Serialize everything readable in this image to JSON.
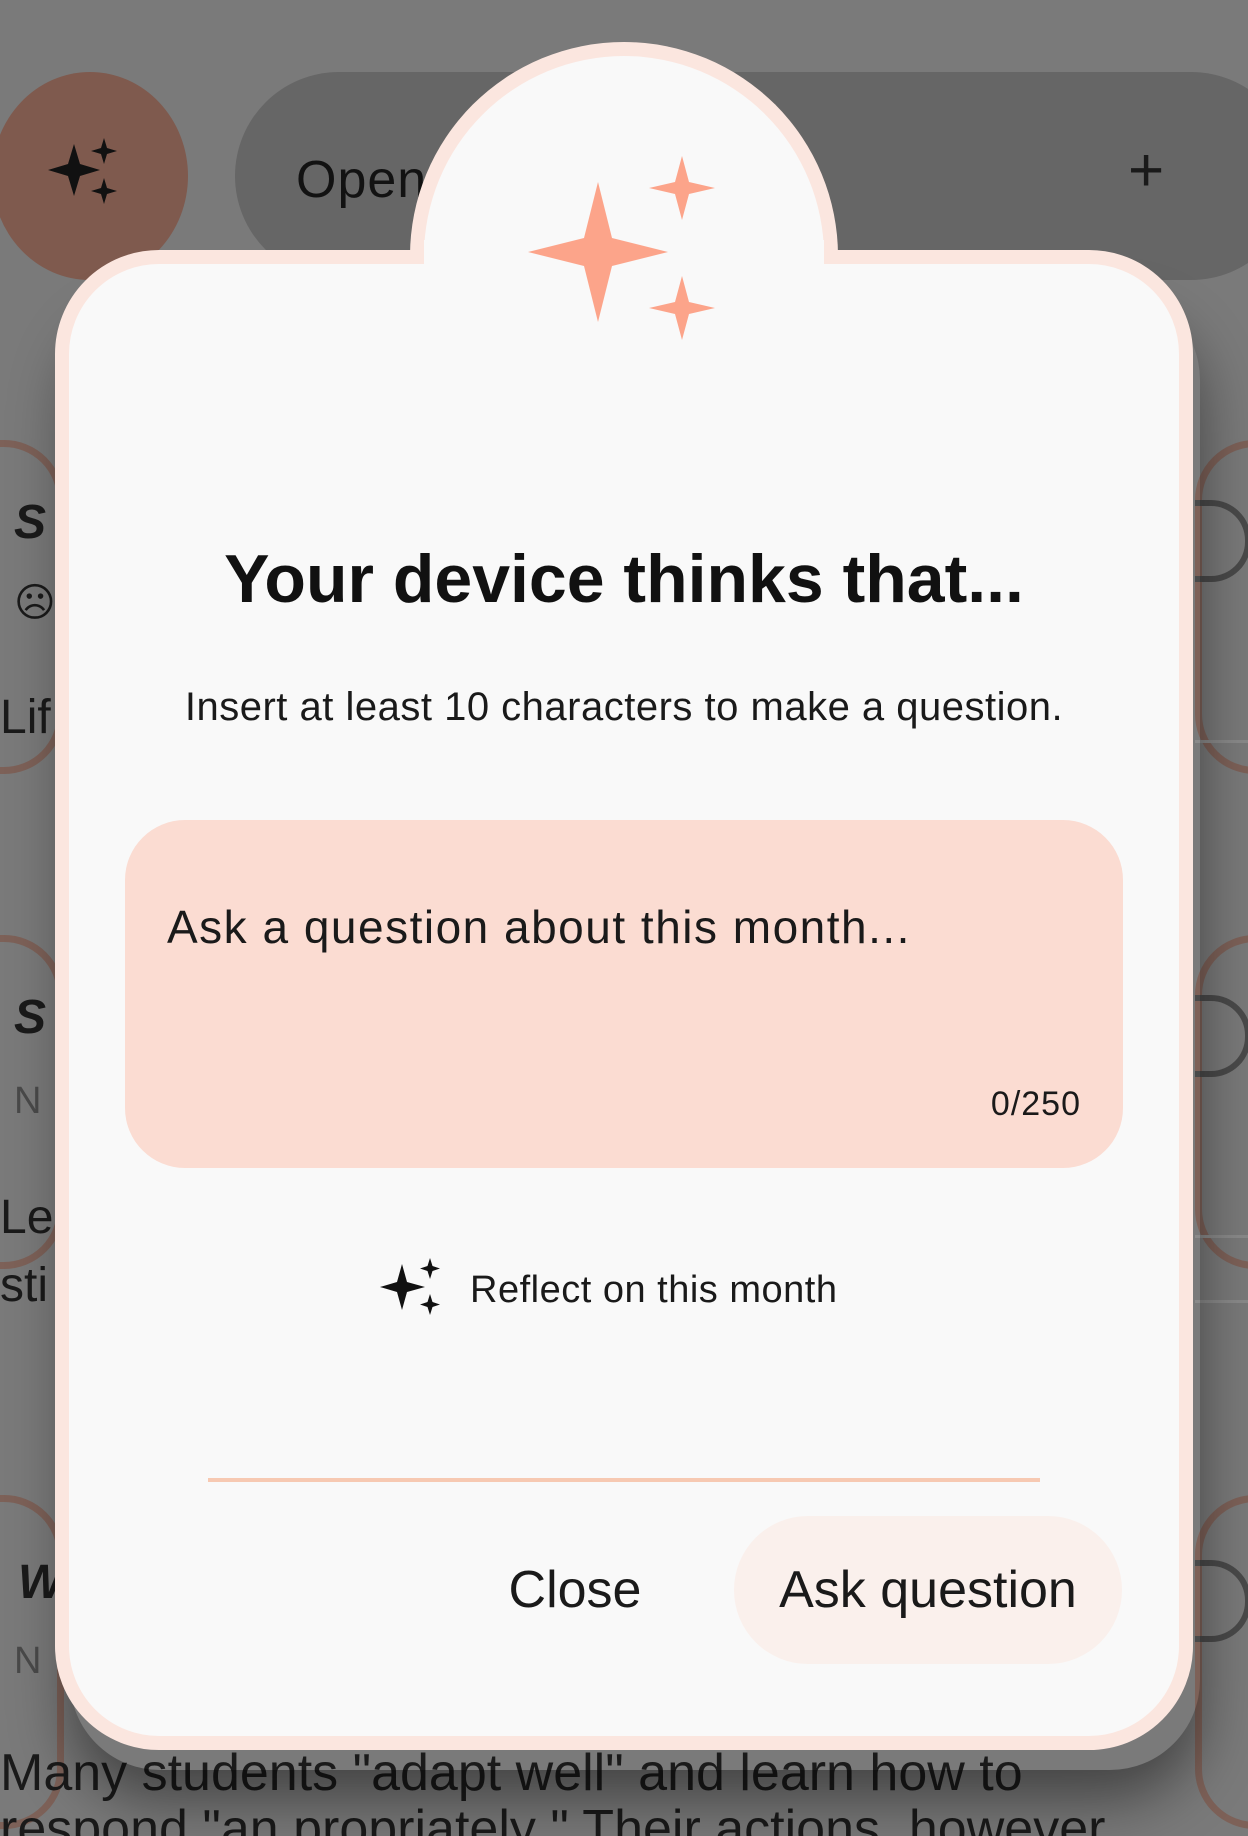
{
  "background": {
    "fab_icon": "sparkles-icon",
    "pill_label": "Open",
    "plus_icon": "+",
    "fragments": [
      "S",
      "☹",
      "Lif",
      "S",
      "N",
      "Le",
      "sti",
      "W",
      "N"
    ],
    "bottom_text_line1": "Many students \"adapt well\" and learn how to",
    "bottom_text_line2": "respond \"an propriately \" Their actions, however"
  },
  "dialog": {
    "header_icon": "sparkles-icon",
    "title": "Your device thinks that...",
    "hint": "Insert at least 10 characters to make a question.",
    "question_field": {
      "value": "",
      "placeholder": "Ask a question about this month...",
      "char_count": "0/250"
    },
    "reflect": {
      "icon": "sparkles-icon",
      "label": "Reflect on this month"
    },
    "buttons": {
      "close_label": "Close",
      "ask_label": "Ask question"
    }
  },
  "colors": {
    "accent": "#fca48a",
    "field_bg": "#fbdcd2",
    "dialog_bg": "#f9f9f9",
    "dialog_border": "#fbe6df",
    "scrim": "#7a7a7a"
  }
}
